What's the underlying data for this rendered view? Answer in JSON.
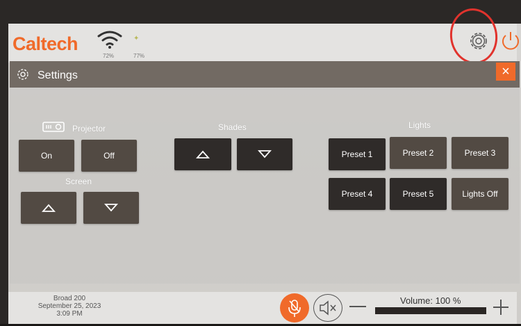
{
  "topbar": {
    "brand": "Caltech",
    "wifi_percent": "72%",
    "battery_percent": "77%",
    "brand_color": "#f06a2a"
  },
  "settings": {
    "title": "Settings",
    "close_label": "×",
    "projector": {
      "label": "Projector",
      "on_label": "On",
      "off_label": "Off"
    },
    "screen": {
      "label": "Screen"
    },
    "shades": {
      "label": "Shades"
    },
    "lights": {
      "label": "Lights",
      "presets": [
        "Preset 1",
        "Preset 2",
        "Preset 3",
        "Preset 4",
        "Preset 5",
        "Lights Off"
      ]
    }
  },
  "footer": {
    "room": "Broad 200",
    "date": "September 25, 2023",
    "time": "3:09 PM",
    "volume_label": "Volume: 100 %",
    "volume_level": 1.0
  },
  "colors": {
    "accent": "#f06a2a",
    "button": "#524a43",
    "annotation": "#e1332d"
  }
}
